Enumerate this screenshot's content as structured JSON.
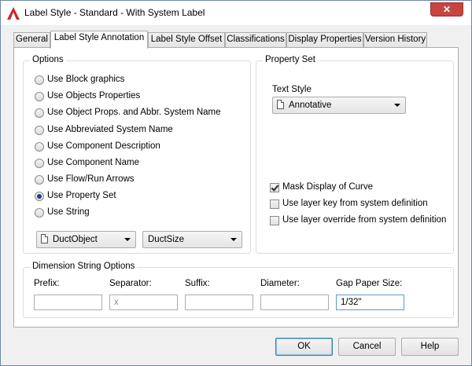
{
  "window": {
    "title": "Label Style - Standard - With System Label",
    "close_glyph": "✕"
  },
  "tabs": [
    {
      "label": "General",
      "active": false
    },
    {
      "label": "Label Style Annotation",
      "active": true
    },
    {
      "label": "Label Style Offset",
      "active": false
    },
    {
      "label": "Classifications",
      "active": false
    },
    {
      "label": "Display Properties",
      "active": false
    },
    {
      "label": "Version History",
      "active": false
    }
  ],
  "options": {
    "label": "Options",
    "radios": [
      {
        "label": "Use Block graphics",
        "checked": false
      },
      {
        "label": "Use Objects Properties",
        "checked": false
      },
      {
        "label": "Use Object Props. and Abbr. System Name",
        "checked": false
      },
      {
        "label": "Use Abbreviated System Name",
        "checked": false
      },
      {
        "label": "Use Component Description",
        "checked": false
      },
      {
        "label": "Use Component Name",
        "checked": false
      },
      {
        "label": "Use Flow/Run Arrows",
        "checked": false
      },
      {
        "label": "Use Property Set",
        "checked": true
      },
      {
        "label": "Use String",
        "checked": false
      }
    ],
    "property_set_combo": "DuctObject",
    "property_combo": "DuctSize"
  },
  "property_set": {
    "label": "Property Set",
    "text_style_label": "Text Style",
    "text_style_value": "Annotative",
    "checkboxes": [
      {
        "label": "Mask Display of Curve",
        "checked": true
      },
      {
        "label": "Use layer key from system definition",
        "checked": false
      },
      {
        "label": "Use layer override from system definition",
        "checked": false
      }
    ]
  },
  "dimension": {
    "label": "Dimension String Options",
    "fields": [
      {
        "label": "Prefix:",
        "value": "",
        "placeholder": ""
      },
      {
        "label": "Separator:",
        "value": "",
        "placeholder": "x"
      },
      {
        "label": "Suffix:",
        "value": "",
        "placeholder": ""
      },
      {
        "label": "Diameter:",
        "value": "",
        "placeholder": ""
      },
      {
        "label": "Gap Paper Size:",
        "value": "1/32\"",
        "placeholder": ""
      }
    ]
  },
  "buttons": {
    "ok": "OK",
    "cancel": "Cancel",
    "help": "Help"
  },
  "colors": {
    "accent": "#3c7fb1",
    "close": "#c7453f",
    "radio_dot": "#1a3f83"
  },
  "icons": {
    "app": "autocad-a-icon",
    "close": "close-icon",
    "combo": "document-icon"
  }
}
